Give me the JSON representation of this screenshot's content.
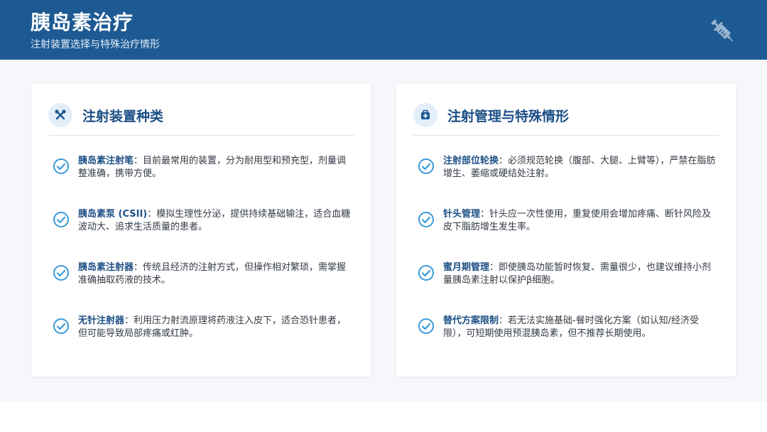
{
  "header": {
    "title": "胰岛素治疗",
    "subtitle": "注射装置选择与特殊治疗情形",
    "icon": "syringe-icon"
  },
  "left_card": {
    "title": "注射装置种类",
    "icon": "tools-icon",
    "items": [
      {
        "key": "胰岛素注射笔",
        "text": "：目前最常用的装置，分为耐用型和预充型，剂量调整准确，携带方便。"
      },
      {
        "key": "胰岛素泵 (CSII)",
        "text": "：模拟生理性分泌，提供持续基础输注，适合血糖波动大、追求生活质量的患者。"
      },
      {
        "key": "胰岛素注射器",
        "text": "：传统且经济的注射方式，但操作相对繁琐，需掌握准确抽取药液的技术。"
      },
      {
        "key": "无针注射器",
        "text": "：利用压力射流原理将药液注入皮下，适合恐针患者，但可能导致局部疼痛或红肿。"
      }
    ]
  },
  "right_card": {
    "title": "注射管理与特殊情形",
    "icon": "medical-kit-icon",
    "items": [
      {
        "key": "注射部位轮换",
        "text": "：必须规范轮换（腹部、大腿、上臂等），严禁在脂肪增生、萎缩或硬结处注射。"
      },
      {
        "key": "针头管理",
        "text": "：针头应一次性使用，重复使用会增加疼痛、断针风险及皮下脂肪增生发生率。"
      },
      {
        "key": "蜜月期管理",
        "text": "：即使胰岛功能暂时恢复、需量很少，也建议维持小剂量胰岛素注射以保护β细胞。"
      },
      {
        "key": "替代方案限制",
        "text": "：若无法实施基础-餐时强化方案（如认知/经济受限），可短期使用预混胰岛素，但不推荐长期使用。"
      }
    ]
  },
  "colors": {
    "header_bg": "#1d5a94",
    "accent": "#1d4f86",
    "check": "#3a9ad9"
  }
}
